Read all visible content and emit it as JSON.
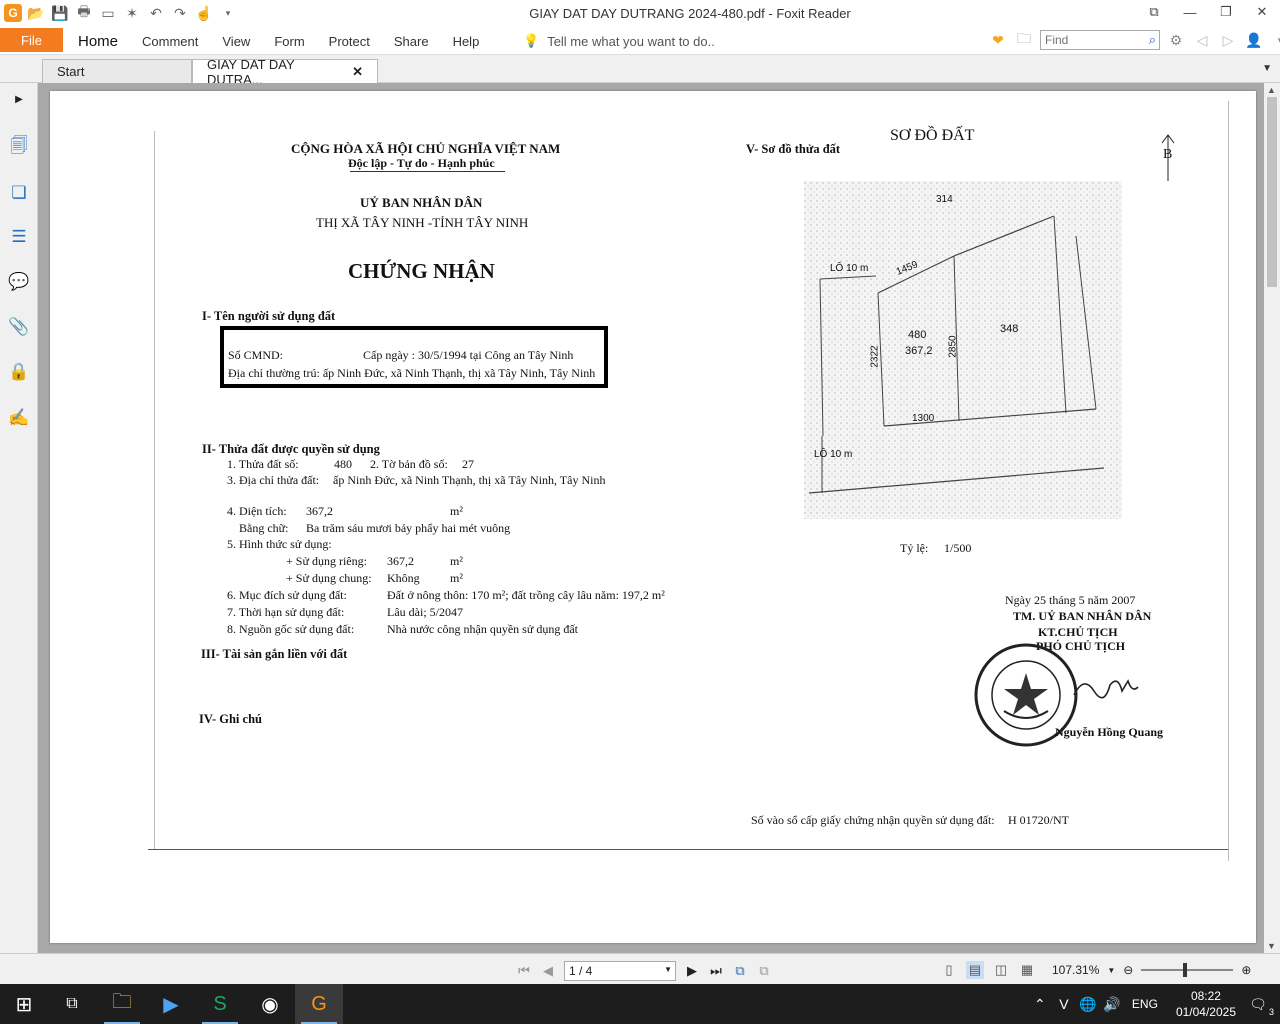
{
  "window": {
    "title": "GIAY DAT DAY DUTRANG 2024-480.pdf - Foxit Reader"
  },
  "menu": {
    "file": "File",
    "items": [
      "Home",
      "Comment",
      "View",
      "Form",
      "Protect",
      "Share",
      "Help"
    ],
    "tell_me": "Tell me what you want to do..",
    "find_placeholder": "Find"
  },
  "tabs": [
    {
      "label": "Start"
    },
    {
      "label": "GIAY DAT DAY DUTRA...",
      "active": true
    }
  ],
  "document": {
    "header_republic": "CỘNG HÒA XÃ HỘI CHỦ NGHĨA VIỆT NAM",
    "header_motto": "Độc lập - Tự do - Hạnh phúc",
    "committee": "UỶ BAN NHÂN DÂN",
    "committee_place": "THỊ XÃ TÂY NINH -TỈNH TÂY NINH",
    "cert_title": "CHỨNG NHẬN",
    "sec1_title": "I- Tên người sử dụng đất",
    "id_label": "Số CMND:",
    "id_issue": "Cấp ngày : 30/5/1994 tại Công an Tây Ninh",
    "address_line": "Địa chỉ thường trú: ấp Ninh Đức, xã Ninh Thạnh, thị xã Tây Ninh, Tây Ninh",
    "sec2_title": "II- Thửa đất được quyền sử dụng",
    "parcel_no_label": "1. Thửa đất số:",
    "parcel_no": "480",
    "map_sheet_label": "2. Tờ bản đồ số:",
    "map_sheet": "27",
    "parcel_addr_label": "3. Địa chỉ thửa đất:",
    "parcel_addr": "ấp Ninh Đức, xã Ninh Thạnh, thị xã Tây Ninh, Tây Ninh",
    "area_label": "4. Diện tích:",
    "area": "367,2",
    "area_unit": "m²",
    "area_words_label": "Bằng chữ:",
    "area_words": "Ba trăm sáu mươi bảy phẩy hai mét vuông",
    "use_form_label": "5. Hình thức sử dụng:",
    "private_use_label": "+ Sử dụng riêng:",
    "private_use": "367,2",
    "common_use_label": "+ Sử dụng chung:",
    "common_use": "Không",
    "purpose_label": "6. Mục đích sử dụng đất:",
    "purpose": "Đất ở nông thôn: 170 m²; đất trồng cây lâu năm: 197,2 m²",
    "term_label": "7. Thời hạn sử dụng đất:",
    "term": "Lâu dài; 5/2047",
    "origin_label": "8. Nguồn gốc sử dụng đất:",
    "origin": "Nhà nước công nhận quyền sử dụng đất",
    "sec3_title": "III- Tài sản gắn liền với đất",
    "sec4_title": "IV- Ghi chú",
    "map_title": "SƠ ĐỒ ĐẤT",
    "sec5_title": "V- Sơ đồ thửa đất",
    "north": "B",
    "map_labels": {
      "lo_top": "LÔ 10 m",
      "lo_bottom": "LÔ 10 m",
      "p314": "314",
      "d1459": "1459",
      "d2322": "2322",
      "p480": "480",
      "a3672": "367,2",
      "d2850": "2850",
      "p348": "348",
      "d1300": "1300"
    },
    "scale_label": "Tỷ lệ:",
    "scale": "1/500",
    "date_line": "Ngày   25    tháng   5   năm 2007",
    "sign_1": "TM. UỶ BAN NHÂN DÂN",
    "sign_2": "KT.CHỦ TỊCH",
    "sign_3": "PHÓ CHỦ TỊCH",
    "signer": "Nguyễn Hồng Quang",
    "registry_label": "Số vào sổ cấp giấy chứng nhận quyền sử dụng đất:",
    "registry_no": "H 01720/NT"
  },
  "status": {
    "page": "1 / 4",
    "zoom": "107.31%"
  },
  "taskbar": {
    "lang": "ENG",
    "time": "08:22",
    "date": "01/04/2025",
    "notifications": "3"
  }
}
